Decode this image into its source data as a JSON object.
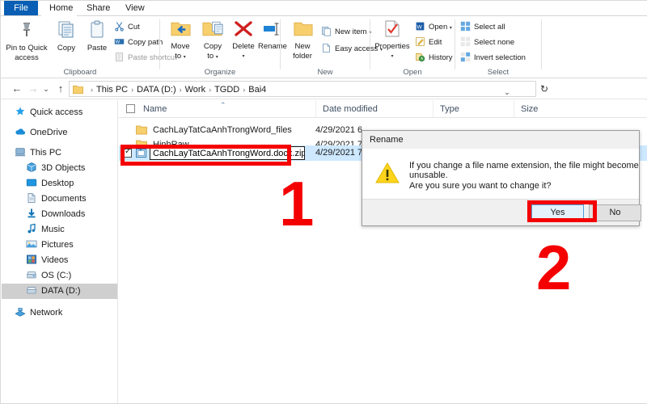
{
  "window": {
    "tabs": [
      {
        "label": "File",
        "name": "tab-file"
      },
      {
        "label": "Home",
        "name": "tab-home"
      },
      {
        "label": "Share",
        "name": "tab-share"
      },
      {
        "label": "View",
        "name": "tab-view"
      }
    ],
    "accent_color": "#0a5fb4",
    "annotation_color": "#f40000"
  },
  "ribbon": {
    "groups": [
      {
        "label": "Clipboard"
      },
      {
        "label": "Organize"
      },
      {
        "label": "New"
      },
      {
        "label": "Open"
      },
      {
        "label": "Select"
      }
    ],
    "clipboard": {
      "pin_line1": "Pin to Quick",
      "pin_line2": "access",
      "copy": "Copy",
      "paste": "Paste",
      "cut": "Cut",
      "copy_path": "Copy path",
      "paste_shortcut": "Paste shortcut"
    },
    "organize": {
      "move_to_line1": "Move",
      "move_to_line2": "to",
      "copy_to_line1": "Copy",
      "copy_to_line2": "to",
      "delete": "Delete",
      "rename": "Rename"
    },
    "new_group": {
      "new_folder_line1": "New",
      "new_folder_line2": "folder",
      "new_item": "New item",
      "easy_access": "Easy access"
    },
    "open_group": {
      "properties": "Properties",
      "open": "Open",
      "edit": "Edit",
      "history": "History"
    },
    "select_group": {
      "select_all": "Select all",
      "select_none": "Select none",
      "invert_selection": "Invert selection"
    }
  },
  "address": {
    "back": "←",
    "forward": "→",
    "recent": "⌄",
    "up": "↑",
    "crumbs": [
      "This PC",
      "DATA (D:)",
      "Work",
      "TGDD",
      "Bai4"
    ],
    "separator": "›",
    "dropdown": "⌄",
    "refresh": "↻"
  },
  "sidebar": {
    "items": [
      {
        "label": "Quick access",
        "icon": "star-icon",
        "level": "root",
        "selected": false
      },
      {
        "label": "OneDrive",
        "icon": "cloud-icon",
        "level": "root",
        "selected": false
      },
      {
        "label": "This PC",
        "icon": "pc-icon",
        "level": "root",
        "selected": false
      },
      {
        "label": "3D Objects",
        "icon": "cube-icon",
        "level": "child",
        "selected": false
      },
      {
        "label": "Desktop",
        "icon": "desktop-icon",
        "level": "child",
        "selected": false
      },
      {
        "label": "Documents",
        "icon": "documents-icon",
        "level": "child",
        "selected": false
      },
      {
        "label": "Downloads",
        "icon": "download-icon",
        "level": "child",
        "selected": false
      },
      {
        "label": "Music",
        "icon": "music-icon",
        "level": "child",
        "selected": false
      },
      {
        "label": "Pictures",
        "icon": "pictures-icon",
        "level": "child",
        "selected": false
      },
      {
        "label": "Videos",
        "icon": "videos-icon",
        "level": "child",
        "selected": false
      },
      {
        "label": "OS (C:)",
        "icon": "drive-icon",
        "level": "child",
        "selected": false
      },
      {
        "label": "DATA (D:)",
        "icon": "drive-icon",
        "level": "child",
        "selected": true
      },
      {
        "label": "Network",
        "icon": "network-icon",
        "level": "root",
        "selected": false
      }
    ]
  },
  "filelist": {
    "columns": [
      {
        "label": "Name",
        "name": "column-name"
      },
      {
        "label": "Date modified",
        "name": "column-date-modified"
      },
      {
        "label": "Type",
        "name": "column-type"
      },
      {
        "label": "Size",
        "name": "column-size"
      }
    ],
    "sort_indicator": "⌃",
    "rows": [
      {
        "name": "CachLayTatCaAnhTrongWord_files",
        "date": "4/29/2021 6",
        "type": "",
        "size": "",
        "icon": "folder-icon",
        "selected": false,
        "editing": false
      },
      {
        "name": "HinhRaw",
        "date": "4/29/2021 7",
        "type": "",
        "size": "",
        "icon": "folder-icon",
        "selected": false,
        "editing": false
      },
      {
        "name": "CachLayTatCaAnhTrongWord.docx.zip",
        "date": "4/29/2021 7",
        "type": "",
        "size": "",
        "icon": "zip-icon",
        "selected": true,
        "editing": true
      }
    ],
    "rename_value": "CachLayTatCaAnhTrongWord.docx.zip"
  },
  "dialog": {
    "title": "Rename",
    "icon": "warning-icon",
    "line1": "If you change a file name extension, the file might become unusable.",
    "line2": "Are you sure you want to change it?",
    "buttons": [
      {
        "label": "Yes",
        "name": "dialog-yes-button",
        "focused": true
      },
      {
        "label": "No",
        "name": "dialog-no-button",
        "focused": false
      }
    ]
  },
  "annotations": {
    "step1": "1",
    "step2": "2"
  }
}
